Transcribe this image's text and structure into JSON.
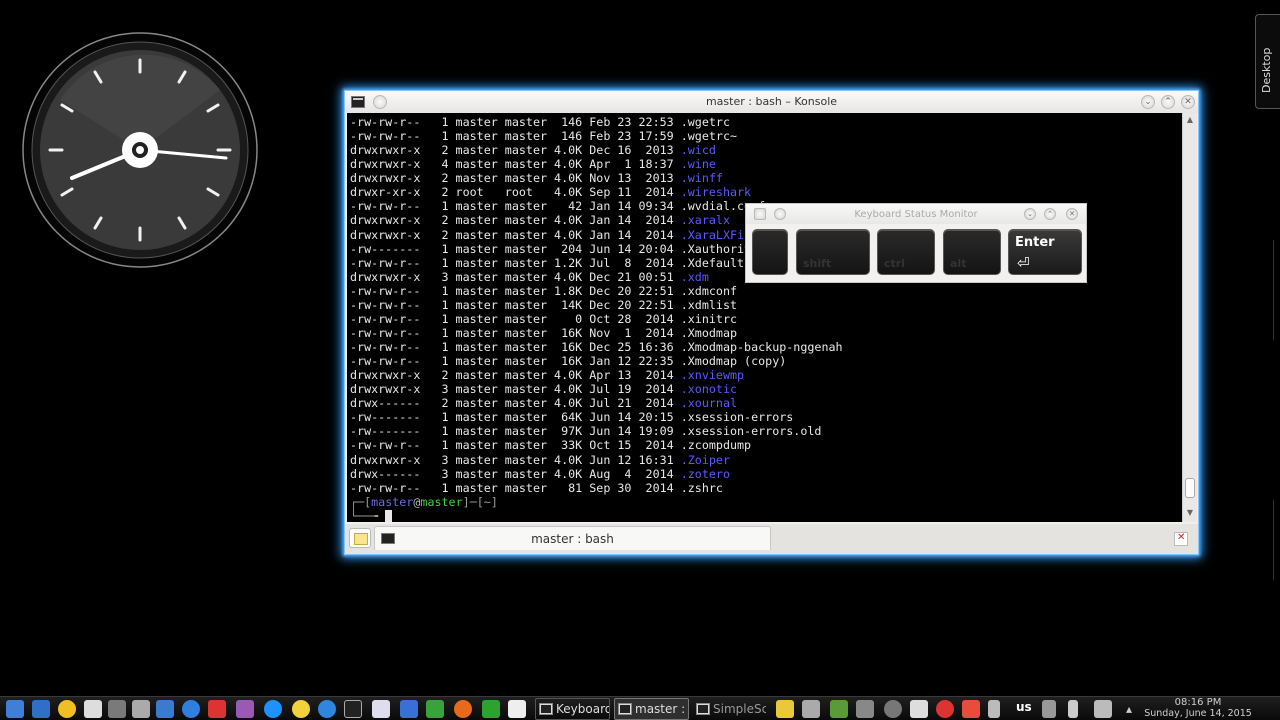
{
  "desktop": {
    "side_tab_label": "Desktop"
  },
  "konsole": {
    "title": "master : bash – Konsole",
    "tab_label": "master : bash",
    "listing": [
      {
        "perms": "-rw-rw-r--",
        "links": "1",
        "owner": "master",
        "group": "master",
        "size": "146",
        "month": "Feb",
        "day": "23",
        "time": "22:53",
        "name": ".wgetrc",
        "dir": false
      },
      {
        "perms": "-rw-rw-r--",
        "links": "1",
        "owner": "master",
        "group": "master",
        "size": "146",
        "month": "Feb",
        "day": "23",
        "time": "17:59",
        "name": ".wgetrc~",
        "dir": false
      },
      {
        "perms": "drwxrwxr-x",
        "links": "2",
        "owner": "master",
        "group": "master",
        "size": "4.0K",
        "month": "Dec",
        "day": "16",
        "time": "2013",
        "name": ".wicd",
        "dir": true
      },
      {
        "perms": "drwxrwxr-x",
        "links": "4",
        "owner": "master",
        "group": "master",
        "size": "4.0K",
        "month": "Apr",
        "day": "1",
        "time": "18:37",
        "name": ".wine",
        "dir": true
      },
      {
        "perms": "drwxrwxr-x",
        "links": "2",
        "owner": "master",
        "group": "master",
        "size": "4.0K",
        "month": "Nov",
        "day": "13",
        "time": "2013",
        "name": ".winff",
        "dir": true
      },
      {
        "perms": "drwxr-xr-x",
        "links": "2",
        "owner": "root",
        "group": "root",
        "size": "4.0K",
        "month": "Sep",
        "day": "11",
        "time": "2014",
        "name": ".wireshark",
        "dir": true
      },
      {
        "perms": "-rw-rw-r--",
        "links": "1",
        "owner": "master",
        "group": "master",
        "size": "42",
        "month": "Jan",
        "day": "14",
        "time": "09:34",
        "name": ".wvdial.conf",
        "dir": false
      },
      {
        "perms": "drwxrwxr-x",
        "links": "2",
        "owner": "master",
        "group": "master",
        "size": "4.0K",
        "month": "Jan",
        "day": "14",
        "time": "2014",
        "name": ".xaralx",
        "dir": true
      },
      {
        "perms": "drwxrwxr-x",
        "links": "2",
        "owner": "master",
        "group": "master",
        "size": "4.0K",
        "month": "Jan",
        "day": "14",
        "time": "2014",
        "name": ".XaraLXFilter",
        "dir": true
      },
      {
        "perms": "-rw-------",
        "links": "1",
        "owner": "master",
        "group": "master",
        "size": "204",
        "month": "Jun",
        "day": "14",
        "time": "20:04",
        "name": ".Xauthority",
        "dir": false
      },
      {
        "perms": "-rw-rw-r--",
        "links": "1",
        "owner": "master",
        "group": "master",
        "size": "1.2K",
        "month": "Jul",
        "day": "8",
        "time": "2014",
        "name": ".Xdefaults",
        "dir": false
      },
      {
        "perms": "drwxrwxr-x",
        "links": "3",
        "owner": "master",
        "group": "master",
        "size": "4.0K",
        "month": "Dec",
        "day": "21",
        "time": "00:51",
        "name": ".xdm",
        "dir": true
      },
      {
        "perms": "-rw-rw-r--",
        "links": "1",
        "owner": "master",
        "group": "master",
        "size": "1.8K",
        "month": "Dec",
        "day": "20",
        "time": "22:51",
        "name": ".xdmconf",
        "dir": false
      },
      {
        "perms": "-rw-rw-r--",
        "links": "1",
        "owner": "master",
        "group": "master",
        "size": "14K",
        "month": "Dec",
        "day": "20",
        "time": "22:51",
        "name": ".xdmlist",
        "dir": false
      },
      {
        "perms": "-rw-rw-r--",
        "links": "1",
        "owner": "master",
        "group": "master",
        "size": "0",
        "month": "Oct",
        "day": "28",
        "time": "2014",
        "name": ".xinitrc",
        "dir": false
      },
      {
        "perms": "-rw-rw-r--",
        "links": "1",
        "owner": "master",
        "group": "master",
        "size": "16K",
        "month": "Nov",
        "day": "1",
        "time": "2014",
        "name": ".Xmodmap",
        "dir": false
      },
      {
        "perms": "-rw-rw-r--",
        "links": "1",
        "owner": "master",
        "group": "master",
        "size": "16K",
        "month": "Dec",
        "day": "25",
        "time": "16:36",
        "name": ".Xmodmap-backup-nggenah",
        "dir": false
      },
      {
        "perms": "-rw-rw-r--",
        "links": "1",
        "owner": "master",
        "group": "master",
        "size": "16K",
        "month": "Jan",
        "day": "12",
        "time": "22:35",
        "name": ".Xmodmap (copy)",
        "dir": false
      },
      {
        "perms": "drwxrwxr-x",
        "links": "2",
        "owner": "master",
        "group": "master",
        "size": "4.0K",
        "month": "Apr",
        "day": "13",
        "time": "2014",
        "name": ".xnviewmp",
        "dir": true
      },
      {
        "perms": "drwxrwxr-x",
        "links": "3",
        "owner": "master",
        "group": "master",
        "size": "4.0K",
        "month": "Jul",
        "day": "19",
        "time": "2014",
        "name": ".xonotic",
        "dir": true
      },
      {
        "perms": "drwx------",
        "links": "2",
        "owner": "master",
        "group": "master",
        "size": "4.0K",
        "month": "Jul",
        "day": "21",
        "time": "2014",
        "name": ".xournal",
        "dir": true
      },
      {
        "perms": "-rw-------",
        "links": "1",
        "owner": "master",
        "group": "master",
        "size": "64K",
        "month": "Jun",
        "day": "14",
        "time": "20:15",
        "name": ".xsession-errors",
        "dir": false
      },
      {
        "perms": "-rw-------",
        "links": "1",
        "owner": "master",
        "group": "master",
        "size": "97K",
        "month": "Jun",
        "day": "14",
        "time": "19:09",
        "name": ".xsession-errors.old",
        "dir": false
      },
      {
        "perms": "-rw-rw-r--",
        "links": "1",
        "owner": "master",
        "group": "master",
        "size": "33K",
        "month": "Oct",
        "day": "15",
        "time": "2014",
        "name": ".zcompdump",
        "dir": false
      },
      {
        "perms": "drwxrwxr-x",
        "links": "3",
        "owner": "master",
        "group": "master",
        "size": "4.0K",
        "month": "Jun",
        "day": "12",
        "time": "16:31",
        "name": ".Zoiper",
        "dir": true
      },
      {
        "perms": "drwx------",
        "links": "3",
        "owner": "master",
        "group": "master",
        "size": "4.0K",
        "month": "Aug",
        "day": "4",
        "time": "2014",
        "name": ".zotero",
        "dir": true
      },
      {
        "perms": "-rw-rw-r--",
        "links": "1",
        "owner": "master",
        "group": "master",
        "size": "81",
        "month": "Sep",
        "day": "30",
        "time": "2014",
        "name": ".zshrc",
        "dir": false
      }
    ],
    "prompt": {
      "open": "┌─[",
      "user": "master",
      "at": "@",
      "host": "master",
      "mid": "]─[",
      "dir": "~",
      "close": "]",
      "second_line": "└──╼ "
    }
  },
  "keyboard_monitor": {
    "title": "Keyboard Status Monitor",
    "keys": [
      {
        "label": "",
        "active": false
      },
      {
        "label": "shift",
        "active": false
      },
      {
        "label": "ctrl",
        "active": false
      },
      {
        "label": "alt",
        "active": false
      },
      {
        "label": "Enter",
        "active": true,
        "symbol": "⏎"
      }
    ]
  },
  "taskbar": {
    "tasks": [
      {
        "label": "Keyboard Status Monitor",
        "current": false
      },
      {
        "label": "master : bash",
        "current": true
      },
      {
        "label": "SimpleScreenRecorder",
        "current": false
      }
    ],
    "lang": "us",
    "time": "08:16 PM",
    "date": "Sunday, June 14, 2015"
  },
  "colors": {
    "dir_text": "#5a5aff",
    "window_glow": "#2f9bff",
    "prompt_host": "#3ccf3c"
  }
}
